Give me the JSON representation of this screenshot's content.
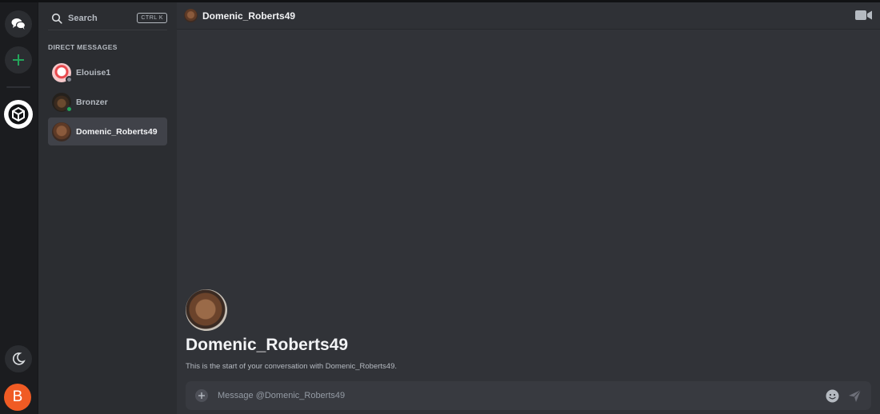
{
  "rail": {
    "icons": [
      "chat-bubbles-icon",
      "plus-icon",
      "cube-icon",
      "moon-icon"
    ],
    "user_initial": "B",
    "colors": {
      "accent_plus": "#23a55a",
      "user_avatar": "#f05b24"
    }
  },
  "sidebar": {
    "search_label": "Search",
    "search_shortcut": "CTRL K",
    "section_title": "DIRECT MESSAGES",
    "dms": [
      {
        "name": "Elouise1",
        "status": "offline",
        "active": false
      },
      {
        "name": "Bronzer",
        "status": "online",
        "active": false
      },
      {
        "name": "Domenic_Roberts49",
        "status": "none",
        "active": true
      }
    ],
    "colors": {
      "online": "#23a55a",
      "offline": "#80848e"
    }
  },
  "header": {
    "title": "Domenic_Roberts49",
    "video_icon": "video-camera-icon"
  },
  "intro": {
    "name": "Domenic_Roberts49",
    "subtitle": "This is the start of your conversation with Domenic_Roberts49."
  },
  "composer": {
    "placeholder": "Message @Domenic_Roberts49",
    "value": "",
    "icons": [
      "plus-circle-icon",
      "emoji-icon",
      "send-icon"
    ]
  }
}
